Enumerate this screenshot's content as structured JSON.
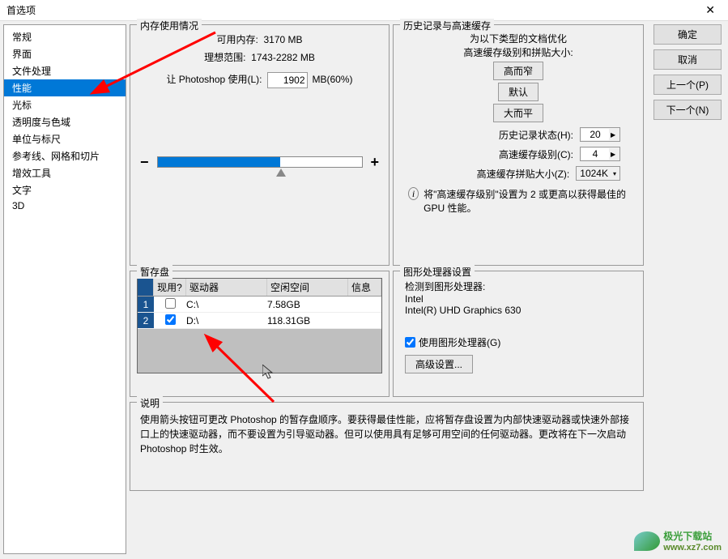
{
  "title": "首选项",
  "sidebar": {
    "items": [
      "常规",
      "界面",
      "文件处理",
      "性能",
      "光标",
      "透明度与色域",
      "单位与标尺",
      "参考线、网格和切片",
      "增效工具",
      "文字",
      "3D"
    ],
    "selected_index": 3
  },
  "buttons": {
    "ok": "确定",
    "cancel": "取消",
    "prev": "上一个(P)",
    "next": "下一个(N)"
  },
  "memory": {
    "legend": "内存使用情况",
    "available_label": "可用内存:",
    "available_value": "3170 MB",
    "ideal_label": "理想范围:",
    "ideal_value": "1743-2282 MB",
    "let_label": "让 Photoshop 使用(L):",
    "let_value": "1902",
    "let_suffix": "MB(60%)",
    "minus": "−",
    "plus": "+"
  },
  "history": {
    "legend": "历史记录与高速缓存",
    "opt1": "为以下类型的文档优化",
    "opt2": "高速缓存级别和拼贴大小:",
    "btn_narrow": "高而窄",
    "btn_default": "默认",
    "btn_wide": "大而平",
    "state_label": "历史记录状态(H):",
    "state_value": "20",
    "cache_label": "高速缓存级别(C):",
    "cache_value": "4",
    "tile_label": "高速缓存拼贴大小(Z):",
    "tile_value": "1024K",
    "hint": "将\"高速缓存级别\"设置为 2 或更高以获得最佳的 GPU 性能。"
  },
  "scratch": {
    "legend": "暂存盘",
    "col_active": "现用?",
    "col_drive": "驱动器",
    "col_free": "空闲空间",
    "col_info": "信息",
    "rows": [
      {
        "idx": "1",
        "checked": false,
        "drive": "C:\\",
        "free": "7.58GB",
        "info": ""
      },
      {
        "idx": "2",
        "checked": true,
        "drive": "D:\\",
        "free": "118.31GB",
        "info": ""
      }
    ]
  },
  "gpu": {
    "legend": "图形处理器设置",
    "detected_label": "检测到图形处理器:",
    "vendor": "Intel",
    "model": "Intel(R) UHD Graphics 630",
    "use_gpu_label": "使用图形处理器(G)",
    "use_gpu_checked": true,
    "advanced": "高级设置..."
  },
  "description": {
    "legend": "说明",
    "text": "使用箭头按钮可更改 Photoshop 的暂存盘顺序。要获得最佳性能，应将暂存盘设置为内部快速驱动器或快速外部接口上的快速驱动器，而不要设置为引导驱动器。但可以使用具有足够可用空间的任何驱动器。更改将在下一次启动 Photoshop 时生效。"
  },
  "watermark": {
    "name": "极光下载站",
    "url": "www.xz7.com"
  }
}
